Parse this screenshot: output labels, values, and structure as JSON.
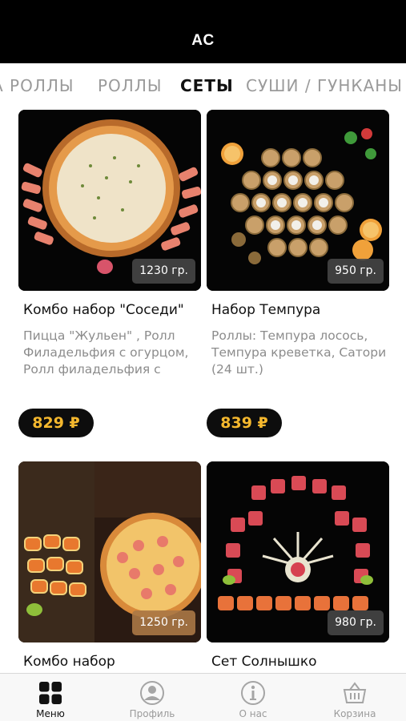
{
  "header": {
    "title": "AC"
  },
  "tabs": [
    {
      "label": "А РОЛЛЫ",
      "active": false
    },
    {
      "label": "РОЛЛЫ",
      "active": false
    },
    {
      "label": "СЕТЫ",
      "active": true
    },
    {
      "label": "СУШИ / ГУНКАНЫ",
      "active": false
    }
  ],
  "products": [
    {
      "title": "Комбо набор \"Соседи\"",
      "description": "Пицца \"Жульен\" , Ролл Филадельфия с огурцом, Ролл филадельфия с",
      "weight": "1230 гр.",
      "price": "829 ₽",
      "image_icon": "pizza-with-rolls-image"
    },
    {
      "title": "Набор Темпура",
      "description": "Роллы: Темпура лосось, Темпура креветка, Сатори (24 шт.)",
      "weight": "950 гр.",
      "price": "839 ₽",
      "image_icon": "tempura-rolls-image"
    },
    {
      "title": "Комбо набор",
      "description": "",
      "weight": "1250 гр.",
      "price": "",
      "image_icon": "combo-pizza-rolls-image"
    },
    {
      "title": "Сет Солнышко",
      "description": "",
      "weight": "980 гр.",
      "price": "",
      "image_icon": "sun-sushi-set-image"
    }
  ],
  "bottom_nav": [
    {
      "label": "Меню",
      "icon": "grid-icon",
      "active": true
    },
    {
      "label": "Профиль",
      "icon": "profile-icon",
      "active": false
    },
    {
      "label": "О нас",
      "icon": "info-icon",
      "active": false
    },
    {
      "label": "Корзина",
      "icon": "basket-icon",
      "active": false
    }
  ],
  "colors": {
    "header_bg": "#000000",
    "price_bg": "#0d0d0d",
    "price_text": "#f5b82e",
    "tab_inactive": "#9a9a9a"
  }
}
